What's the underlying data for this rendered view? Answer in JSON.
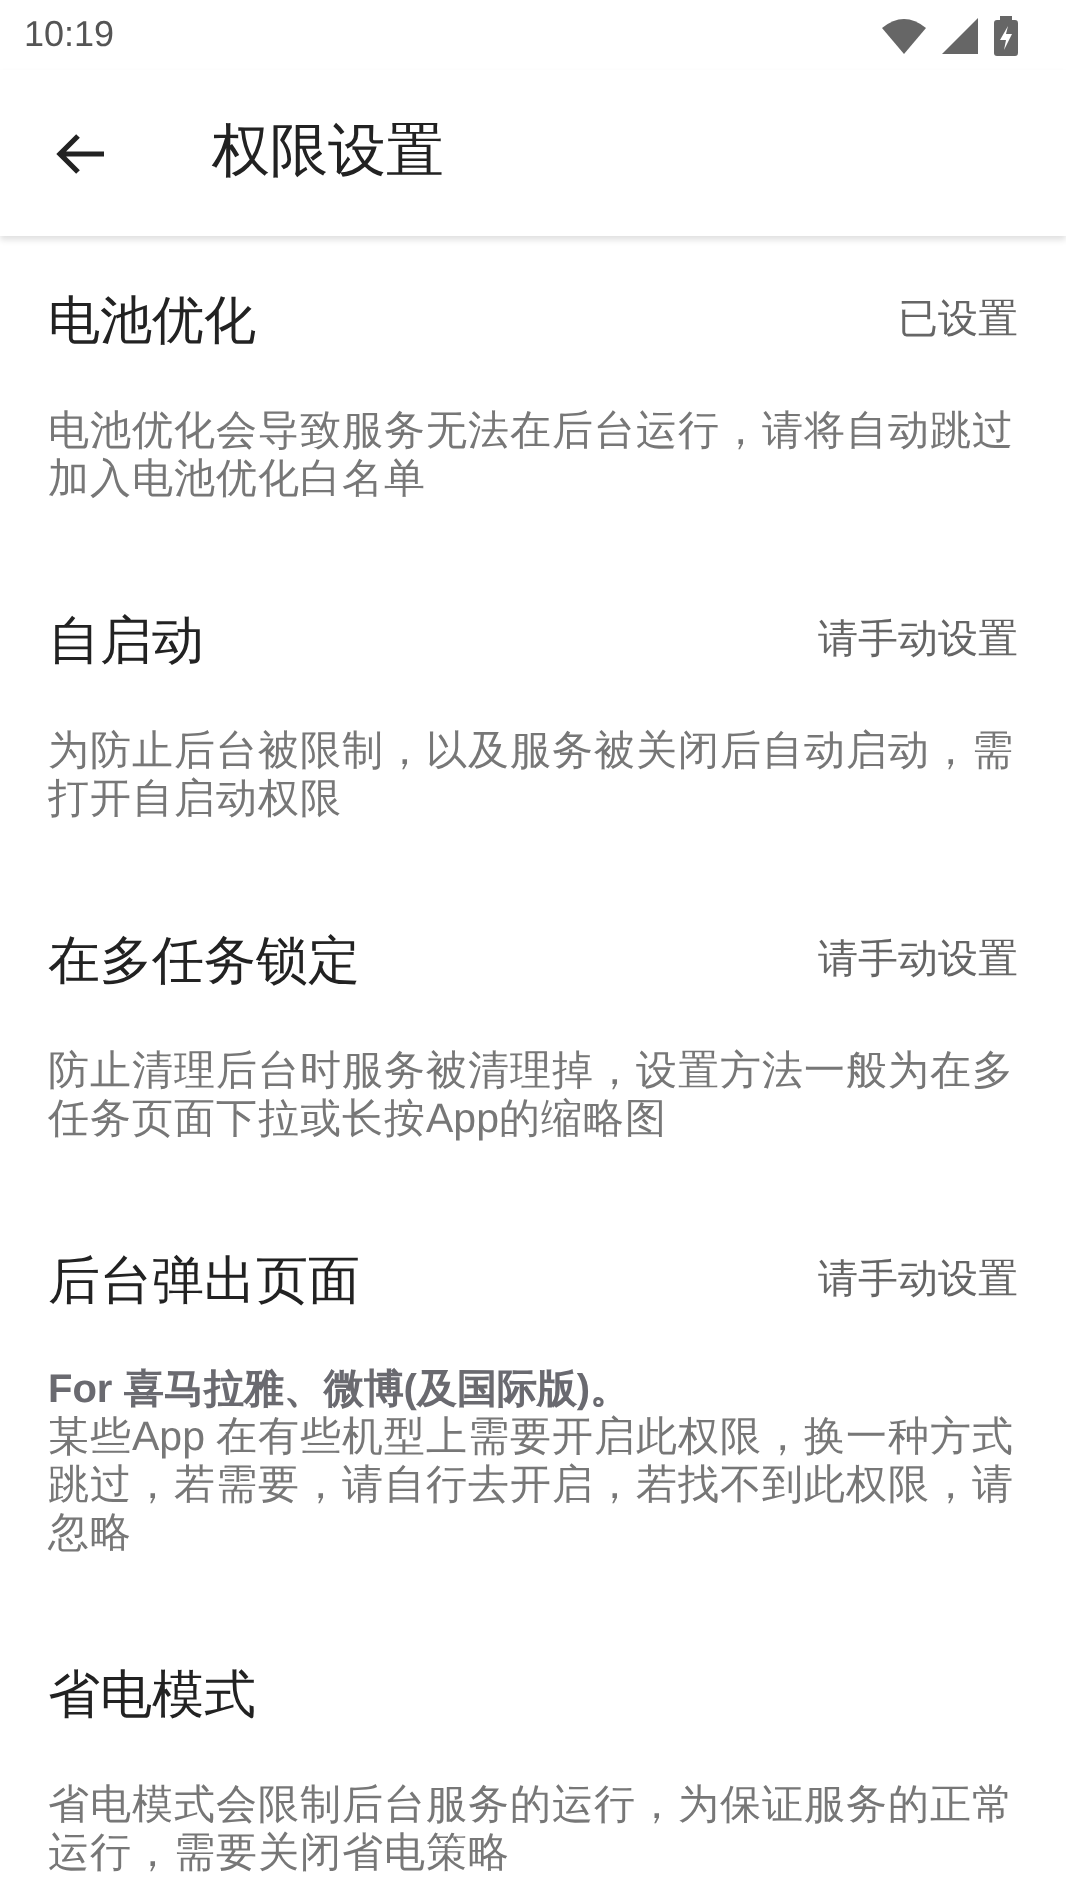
{
  "status_bar": {
    "time": "10:19"
  },
  "toolbar": {
    "title": "权限设置"
  },
  "settings": [
    {
      "title": "电池优化",
      "value": "已设置",
      "description": "电池优化会导致服务无法在后台运行，请将自动跳过加入电池优化白名单"
    },
    {
      "title": "自启动",
      "value": "请手动设置",
      "description": "为防止后台被限制，以及服务被关闭后自动启动，需打开自启动权限"
    },
    {
      "title": "在多任务锁定",
      "value": "请手动设置",
      "description": "防止清理后台时服务被清理掉，设置方法一般为在多任务页面下拉或长按App的缩略图"
    },
    {
      "title": "后台弹出页面",
      "value": "请手动设置",
      "note": "For 喜马拉雅、微博(及国际版)。",
      "description": "某些App 在有些机型上需要开启此权限，换一种方式跳过，若需要，请自行去开启，若找不到此权限，请忽略"
    },
    {
      "title": "省电模式",
      "description": "省电模式会限制后台服务的运行，为保证服务的正常运行，需要关闭省电策略"
    }
  ]
}
